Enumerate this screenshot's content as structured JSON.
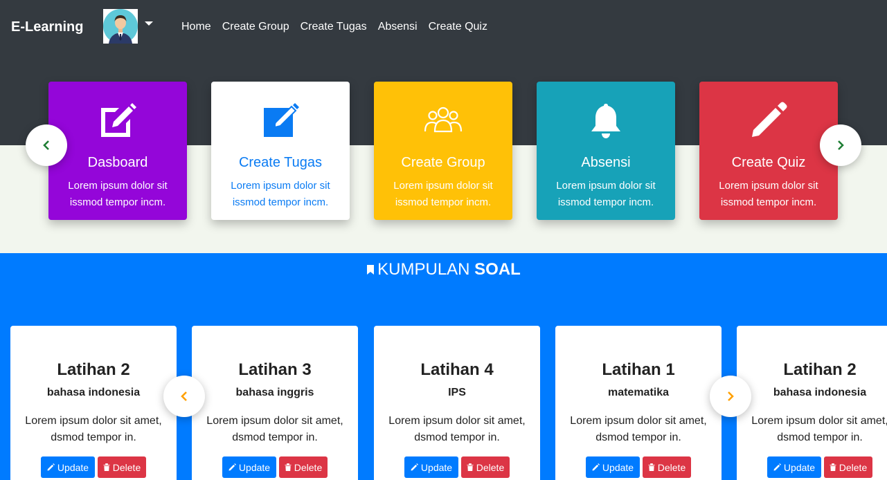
{
  "navbar": {
    "brand": "E-Learning",
    "links": [
      "Home",
      "Create Group",
      "Create Tugas",
      "Absensi",
      "Create Quiz"
    ]
  },
  "menu_cards": [
    {
      "icon": "edit-icon",
      "title": "Dasboard",
      "desc": "Lorem ipsum dolor sit issmod tempor incm.",
      "bg": "#9406d9",
      "fg": "#ffffff"
    },
    {
      "icon": "edit-icon",
      "title": "Create Tugas",
      "desc": "Lorem ipsum dolor sit issmod tempor incm.",
      "bg": "#ffffff",
      "fg": "#0a7bf3"
    },
    {
      "icon": "group-icon",
      "title": "Create Group",
      "desc": "Lorem ipsum dolor sit issmod tempor incm.",
      "bg": "#ffc107",
      "fg": "#ffffff"
    },
    {
      "icon": "bell-icon",
      "title": "Absensi",
      "desc": "Lorem ipsum dolor sit issmod tempor incm.",
      "bg": "#17a2b8",
      "fg": "#ffffff"
    },
    {
      "icon": "pencil-icon",
      "title": "Create Quiz",
      "desc": "Lorem ipsum dolor sit issmod tempor incm.",
      "bg": "#dc3545",
      "fg": "#ffffff"
    }
  ],
  "section": {
    "title_light": "KUMPULAN",
    "title_bold": "SOAL"
  },
  "quizzes": [
    {
      "title": "Latihan 2",
      "subject": "bahasa indonesia",
      "desc": "Lorem ipsum dolor sit amet, dsmod tempor in.",
      "update": "Update",
      "delete": "Delete"
    },
    {
      "title": "Latihan 3",
      "subject": "bahasa inggris",
      "desc": "Lorem ipsum dolor sit amet, dsmod tempor in.",
      "update": "Update",
      "delete": "Delete"
    },
    {
      "title": "Latihan 4",
      "subject": "IPS",
      "desc": "Lorem ipsum dolor sit amet, dsmod tempor in.",
      "update": "Update",
      "delete": "Delete"
    },
    {
      "title": "Latihan 1",
      "subject": "matematika",
      "desc": "Lorem ipsum dolor sit amet, dsmod tempor in.",
      "update": "Update",
      "delete": "Delete"
    },
    {
      "title": "Latihan 2",
      "subject": "bahasa indonesia",
      "desc": "Lorem ipsum dolor sit amet, dsmod tempor in.",
      "update": "Update",
      "delete": "Delete"
    }
  ],
  "colors": {
    "nav_bg": "#343a40",
    "section_bg": "#007bff",
    "arrow_top": "#1e7e34",
    "arrow_bottom": "#ffa000"
  }
}
